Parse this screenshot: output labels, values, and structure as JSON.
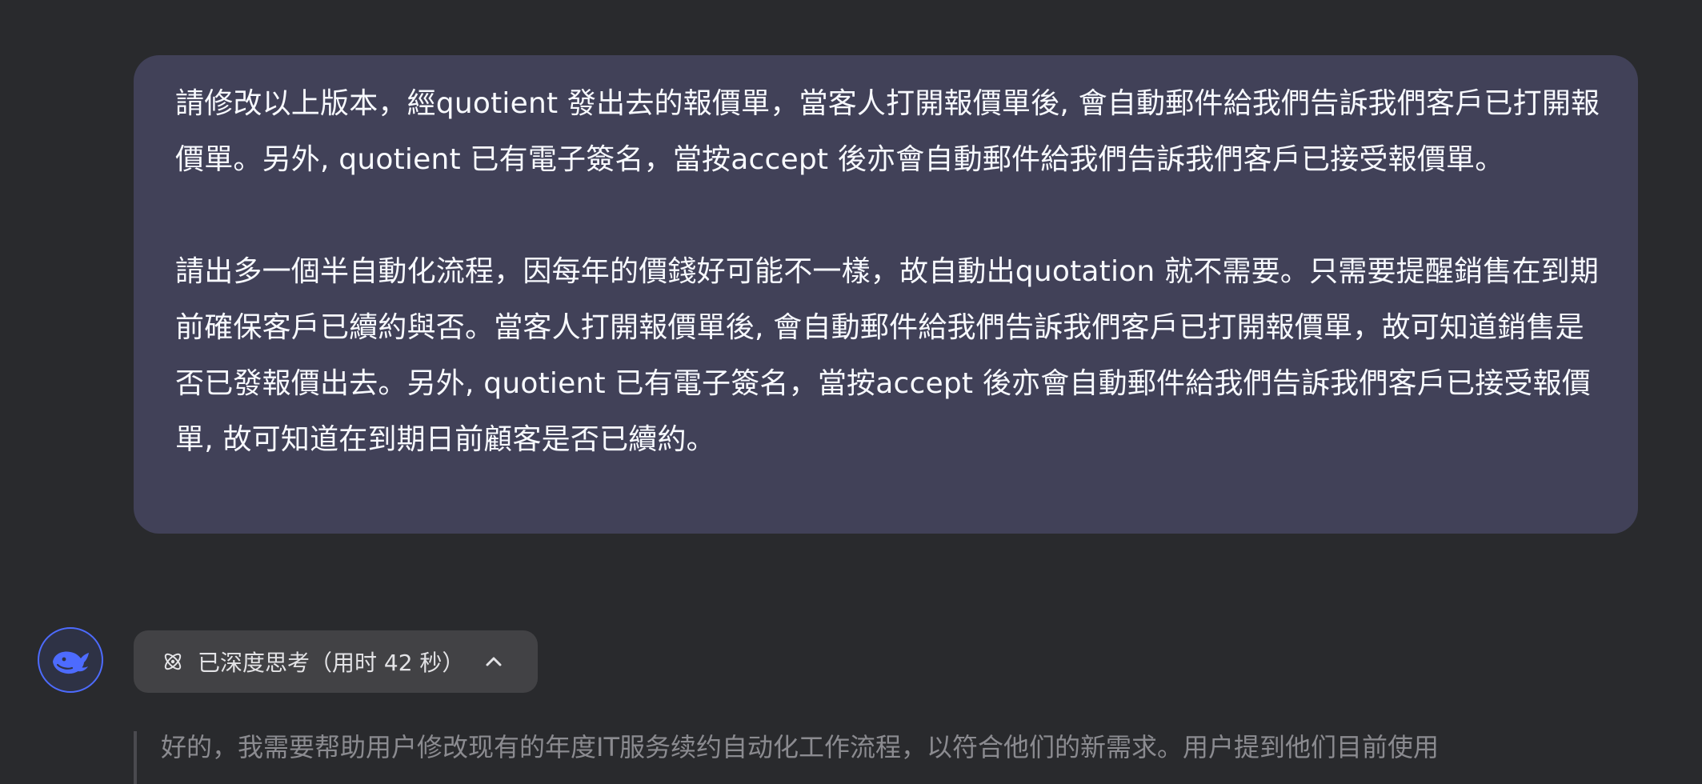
{
  "user_message": {
    "paragraph_1": "請修改以上版本，經quotient 發出去的報價單，當客人打開報價單後, 會自動郵件給我們告訴我們客戶已打開報價單。另外, quotient 已有電子簽名，當按accept 後亦會自動郵件給我們告訴我們客戶已接受報價單。",
    "paragraph_2": "請出多一個半自動化流程，因每年的價錢好可能不一樣，故自動出quotation 就不需要。只需要提醒銷售在到期前確保客戶已續約與否。當客人打開報價單後, 會自動郵件給我們告訴我們客戶已打開報價單，故可知道銷售是否已發報價出去。另外, quotient 已有電子簽名，當按accept 後亦會自動郵件給我們告訴我們客戶已接受報價單, 故可知道在到期日前顧客是否已續約。"
  },
  "assistant": {
    "avatar_icon": "whale-icon",
    "think_toggle": {
      "icon": "atom-icon",
      "label": "已深度思考（用时 42 秒）",
      "chevron_icon": "chevron-up-icon"
    },
    "thought_text": "好的，我需要帮助用户修改现有的年度IT服务续约自动化工作流程，以符合他们的新需求。用户提到他们目前使用"
  },
  "colors": {
    "background": "#292a2d",
    "user_bubble": "#414158",
    "accent": "#4d6bfe",
    "toggle_bg": "#424245",
    "thought_text": "#8b8b90"
  }
}
